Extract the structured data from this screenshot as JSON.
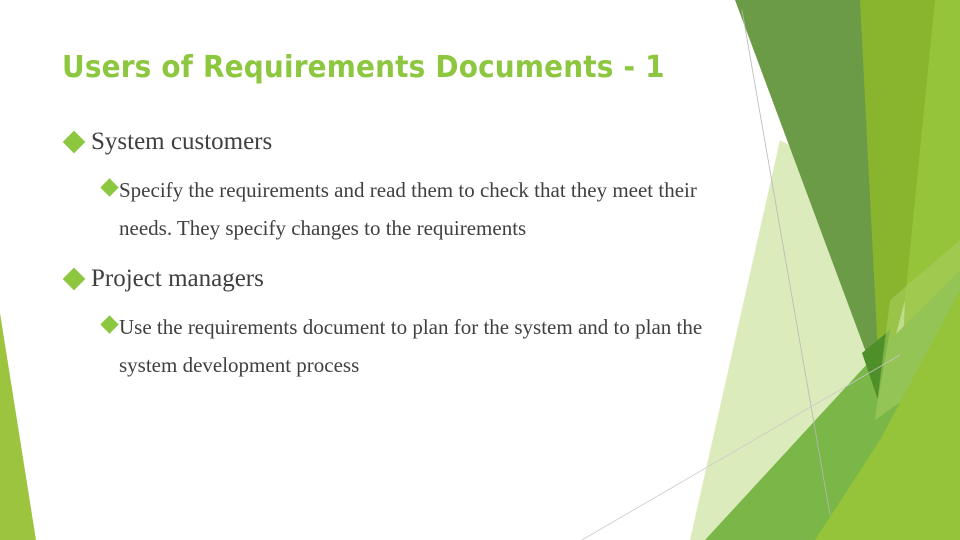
{
  "slide": {
    "title": "Users of Requirements Documents - 1",
    "accent_color": "#8dc63f",
    "text_color": "#404040",
    "bullet_icon": "diamond-bullet",
    "items": [
      {
        "text": "System customers",
        "children": [
          {
            "text": "Specify the requirements and read them to check that they meet their needs.  They specify changes to the requirements"
          }
        ]
      },
      {
        "text": "Project managers",
        "children": [
          {
            "text": "Use the requirements document to plan for the system and to plan the system development process"
          }
        ]
      }
    ]
  },
  "decoration": {
    "palette": {
      "dark_green": "#6b9b46",
      "mid_green": "#7ab648",
      "olive_green": "#88b42e",
      "lime_green": "#95c43a",
      "pale_green": "#d6e8b0",
      "deep_green": "#4f8f29",
      "line_gray": "#b8b8b8"
    }
  }
}
